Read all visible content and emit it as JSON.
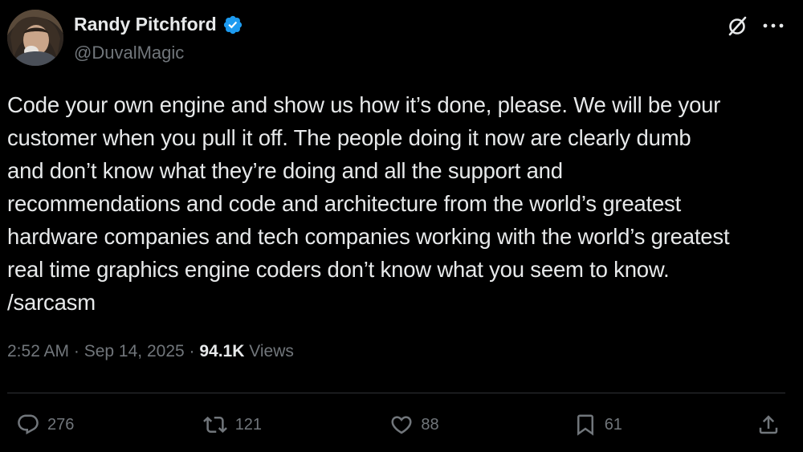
{
  "author": {
    "display_name": "Randy Pitchford",
    "handle": "@DuvalMagic",
    "verified": true,
    "verified_color": "#1d9bf0"
  },
  "top_actions": {
    "grok_icon": "grok-slash-circle-icon",
    "more_icon": "more-dots-icon"
  },
  "tweet": {
    "lines": [
      "Code your own engine and show us how it’s done, please.  We will be your",
      "customer when you pull it off. The people doing it now are clearly dumb",
      "and don’t know what they’re doing and all the support and",
      "recommendations and code and architecture from the world’s greatest",
      "hardware companies and tech companies working with the world’s greatest",
      "real time graphics engine coders don’t know what you seem to know.",
      "/sarcasm"
    ]
  },
  "meta": {
    "time": "2:52 AM",
    "separator": " · ",
    "date": "Sep 14, 2025",
    "views_count": "94.1K",
    "views_label": " Views"
  },
  "actions": {
    "replies": "276",
    "reposts": "121",
    "likes": "88",
    "bookmarks": "61"
  },
  "colors": {
    "background": "#000000",
    "text": "#e7e9ea",
    "muted": "#71767b",
    "divider": "#2f3336"
  }
}
